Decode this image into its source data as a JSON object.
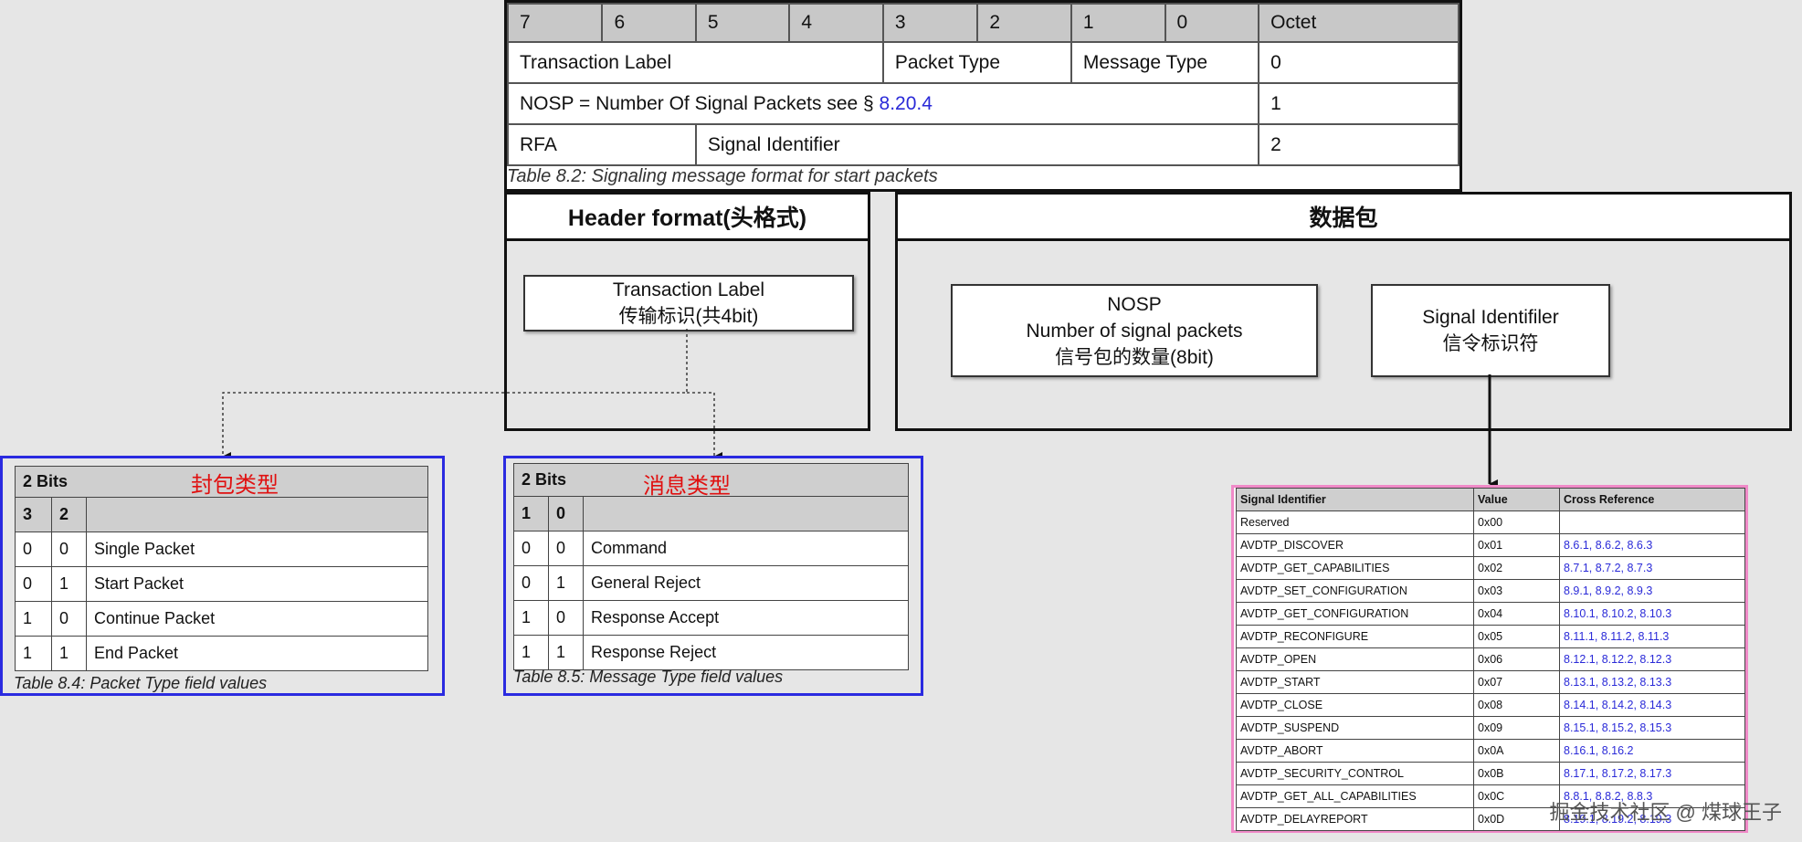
{
  "format_table": {
    "header": [
      "7",
      "6",
      "5",
      "4",
      "3",
      "2",
      "1",
      "0",
      "Octet"
    ],
    "row1": {
      "transaction_label": "Transaction Label",
      "packet_type": "Packet Type",
      "message_type": "Message Type",
      "octet": "0"
    },
    "row2": {
      "nosp_text": "NOSP = Number Of Signal Packets see § ",
      "nosp_ref": "8.20.4",
      "octet": "1"
    },
    "row3": {
      "rfa": "RFA",
      "signal_identifier": "Signal Identifier",
      "octet": "2"
    },
    "caption": "Table 8.2: Signaling message format for start packets"
  },
  "header_panel": {
    "title": "Header  format(头格式)",
    "box_line1": "Transaction Label",
    "box_line2": "传输标识(共4bit)"
  },
  "data_panel": {
    "title": "数据包",
    "nosp_line1": "NOSP",
    "nosp_line2": "Number of signal packets",
    "nosp_line3": "信号包的数量(8bit)",
    "sig_line1": "Signal Identifiler",
    "sig_line2": "信令标识符"
  },
  "packet_table": {
    "bits_label": "2 Bits",
    "title": "封包类型",
    "col_a": "3",
    "col_b": "2",
    "rows": [
      [
        "0",
        "0",
        "Single Packet"
      ],
      [
        "0",
        "1",
        "Start Packet"
      ],
      [
        "1",
        "0",
        "Continue Packet"
      ],
      [
        "1",
        "1",
        "End Packet"
      ]
    ],
    "caption": "Table 8.4: Packet Type field values"
  },
  "message_table": {
    "bits_label": "2 Bits",
    "title": "消息类型",
    "col_a": "1",
    "col_b": "0",
    "rows": [
      [
        "0",
        "0",
        "Command"
      ],
      [
        "0",
        "1",
        "General Reject"
      ],
      [
        "1",
        "0",
        "Response Accept"
      ],
      [
        "1",
        "1",
        "Response Reject"
      ]
    ],
    "caption": "Table 8.5: Message Type field values"
  },
  "signal_table": {
    "headers": [
      "Signal Identifier",
      "Value",
      "Cross Reference"
    ],
    "rows": [
      [
        "Reserved",
        "0x00",
        ""
      ],
      [
        "AVDTP_DISCOVER",
        "0x01",
        "8.6.1, 8.6.2, 8.6.3"
      ],
      [
        "AVDTP_GET_CAPABILITIES",
        "0x02",
        "8.7.1, 8.7.2, 8.7.3"
      ],
      [
        "AVDTP_SET_CONFIGURATION",
        "0x03",
        "8.9.1, 8.9.2, 8.9.3"
      ],
      [
        "AVDTP_GET_CONFIGURATION",
        "0x04",
        "8.10.1, 8.10.2, 8.10.3"
      ],
      [
        "AVDTP_RECONFIGURE",
        "0x05",
        "8.11.1, 8.11.2, 8.11.3"
      ],
      [
        "AVDTP_OPEN",
        "0x06",
        "8.12.1, 8.12.2, 8.12.3"
      ],
      [
        "AVDTP_START",
        "0x07",
        "8.13.1, 8.13.2, 8.13.3"
      ],
      [
        "AVDTP_CLOSE",
        "0x08",
        "8.14.1, 8.14.2, 8.14.3"
      ],
      [
        "AVDTP_SUSPEND",
        "0x09",
        "8.15.1, 8.15.2, 8.15.3"
      ],
      [
        "AVDTP_ABORT",
        "0x0A",
        "8.16.1, 8.16.2"
      ],
      [
        "AVDTP_SECURITY_CONTROL",
        "0x0B",
        "8.17.1, 8.17.2, 8.17.3"
      ],
      [
        "AVDTP_GET_ALL_CAPABILITIES",
        "0x0C",
        "8.8.1, 8.8.2, 8.8.3"
      ],
      [
        "AVDTP_DELAYREPORT",
        "0x0D",
        "8.19.1, 8.19.2, 8.19.3"
      ]
    ]
  },
  "watermark": "掘金技术社区 @ 煤球王子"
}
